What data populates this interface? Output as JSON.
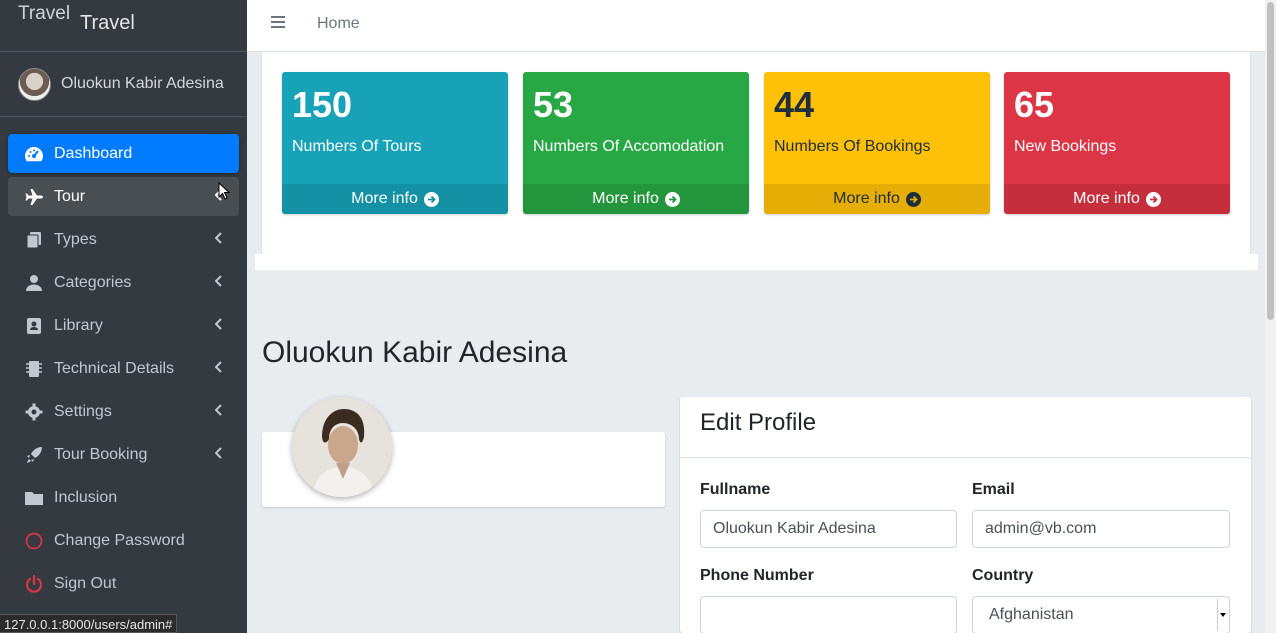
{
  "brand": {
    "logo_alt": "Travel",
    "name": "Travel"
  },
  "user": {
    "name": "Oluokun Kabir Adesina"
  },
  "sidebar": {
    "items": [
      {
        "label": "Dashboard",
        "icon": "tachometer-icon",
        "active": true
      },
      {
        "label": "Tour",
        "icon": "plane-icon",
        "has_children": true
      },
      {
        "label": "Types",
        "icon": "copy-icon",
        "has_children": true
      },
      {
        "label": "Categories",
        "icon": "user-icon",
        "has_children": true
      },
      {
        "label": "Library",
        "icon": "address-book-icon",
        "has_children": true
      },
      {
        "label": "Technical Details",
        "icon": "microchip-icon",
        "has_children": true
      },
      {
        "label": "Settings",
        "icon": "gear-icon",
        "has_children": true
      },
      {
        "label": "Tour Booking",
        "icon": "rocket-icon",
        "has_children": true
      },
      {
        "label": "Inclusion",
        "icon": "folder-icon"
      },
      {
        "label": "Change Password",
        "icon": "circle-icon"
      },
      {
        "label": "Sign Out",
        "icon": "power-icon"
      }
    ]
  },
  "status_url": "127.0.0.1:8000/users/admin#",
  "topbar": {
    "home": "Home"
  },
  "stats": [
    {
      "value": "150",
      "label": "Numbers Of Tours",
      "footer": "More info",
      "color": "#17a2b8"
    },
    {
      "value": "53",
      "label": "Numbers Of Accomodation",
      "footer": "More info",
      "color": "#28a745"
    },
    {
      "value": "44",
      "label": "Numbers Of Bookings",
      "footer": "More info",
      "color": "#ffc107"
    },
    {
      "value": "65",
      "label": "New Bookings",
      "footer": "More info",
      "color": "#dc3545"
    }
  ],
  "profile": {
    "title": "Oluokun Kabir Adesina",
    "edit_title": "Edit Profile",
    "fullname_label": "Fullname",
    "fullname_value": "Oluokun Kabir Adesina",
    "email_label": "Email",
    "email_value": "admin@vb.com",
    "phone_label": "Phone Number",
    "phone_value": "",
    "country_label": "Country",
    "country_value": "Afghanistan"
  }
}
